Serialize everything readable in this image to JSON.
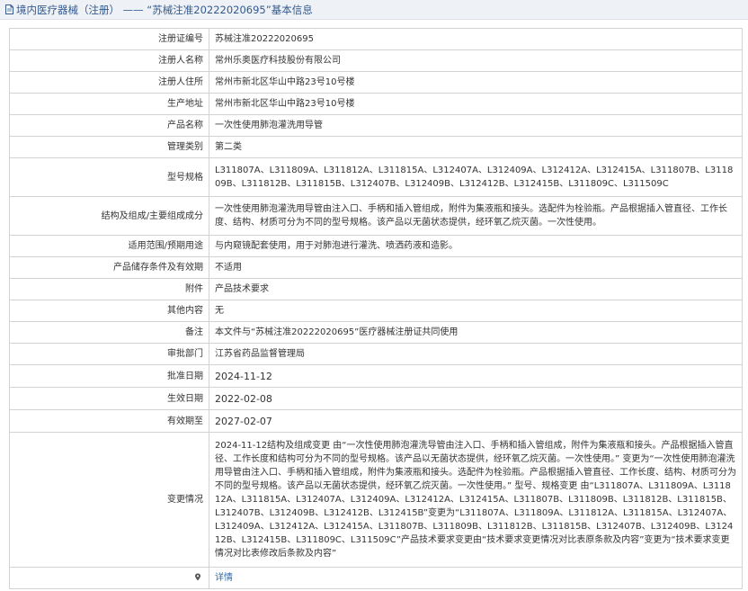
{
  "header": {
    "title": "境内医疗器械（注册） —— “苏械注准20222020695”基本信息"
  },
  "rows": [
    {
      "label": "注册证编号",
      "value": "苏械注准20222020695"
    },
    {
      "label": "注册人名称",
      "value": "常州乐奥医疗科技股份有限公司"
    },
    {
      "label": "注册人住所",
      "value": "常州市新北区华山中路23号10号楼"
    },
    {
      "label": "生产地址",
      "value": "常州市新北区华山中路23号10号楼"
    },
    {
      "label": "产品名称",
      "value": "一次性使用肺泡灌洗用导管"
    },
    {
      "label": "管理类别",
      "value": "第二类"
    },
    {
      "label": "型号规格",
      "value": "L311807A、L311809A、L311812A、L311815A、L312407A、L312409A、L312412A、L312415A、L311807B、L311809B、L311812B、L311815B、L312407B、L312409B、L312412B、L312415B、L311809C、L311509C"
    },
    {
      "label": "结构及组成/主要组成成分",
      "value": "一次性使用肺泡灌洗用导管由注入口、手柄和插入管组成，附件为集液瓶和接头。选配件为栓验瓶。产品根据插入管直径、工作长度、结构、材质可分为不同的型号规格。该产品以无菌状态提供，经环氧乙烷灭菌。一次性使用。"
    },
    {
      "label": "适用范围/预期用途",
      "value": "与内窥镜配套使用，用于对肺泡进行灌洗、喷洒药液和造影。"
    },
    {
      "label": "产品储存条件及有效期",
      "value": "不适用"
    },
    {
      "label": "附件",
      "value": "产品技术要求"
    },
    {
      "label": "其他内容",
      "value": "无"
    },
    {
      "label": "备注",
      "value": "本文件与“苏械注准20222020695”医疗器械注册证共同使用"
    },
    {
      "label": "审批部门",
      "value": "江苏省药品监督管理局"
    },
    {
      "label": "批准日期",
      "value": "2024-11-12"
    },
    {
      "label": "生效日期",
      "value": "2022-02-08"
    },
    {
      "label": "有效期至",
      "value": "2027-02-07"
    },
    {
      "label": "变更情况",
      "value": "2024-11-12结构及组成变更 由“一次性使用肺泡灌洗导管由注入口、手柄和插入管组成，附件为集液瓶和接头。产品根据插入管直径、工作长度和结构可分为不同的型号规格。该产品以无菌状态提供，经环氧乙烷灭菌。一次性使用。” 变更为“一次性使用肺泡灌洗用导管由注入口、手柄和插入管组成，附件为集液瓶和接头。选配件为栓验瓶。产品根据插入管直径、工作长度、结构、材质可分为不同的型号规格。该产品以无菌状态提供，经环氧乙烷灭菌。一次性使用。” 型号、规格变更 由“L311807A、L311809A、L311812A、L311815A、L312407A、L312409A、L312412A、L312415A、L311807B、L311809B、L311812B、L311815B、L312407B、L312409B、L312412B、L312415B”变更为“L311807A、L311809A、L311812A、L311815A、L312407A、L312409A、L312412A、L312415A、L311807B、L311809B、L311812B、L311815B、L312407B、L312409B、L312412B、L312415B、L311809C、L311509C”产品技术要求变更由“技术要求变更情况对比表原条款及内容”变更为“技术要求变更情况对比表修改后条款及内容”"
    }
  ],
  "detail": {
    "label": "",
    "link": "详情"
  },
  "icons": {
    "title": "document-icon",
    "detail": "map-pin-icon"
  },
  "colors": {
    "title_text": "#335a8f",
    "link": "#2b6cb0",
    "border": "#d3d3d3"
  }
}
